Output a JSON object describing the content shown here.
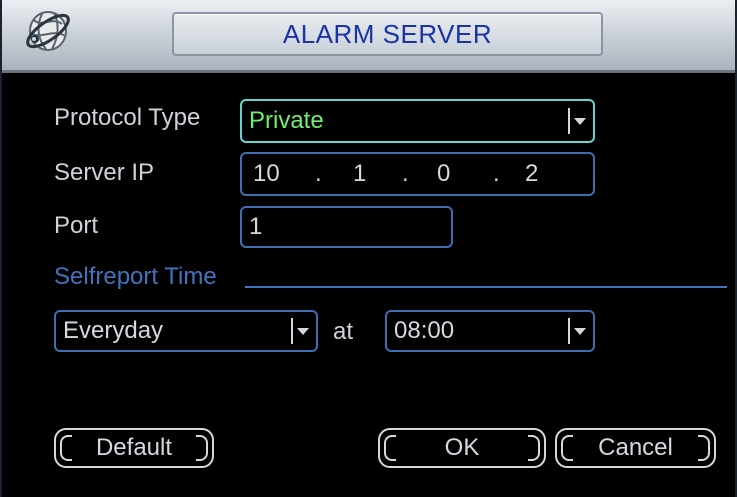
{
  "window": {
    "title": "ALARM SERVER"
  },
  "form": {
    "protocol_type": {
      "label": "Protocol Type",
      "value": "Private"
    },
    "server_ip": {
      "label": "Server IP",
      "octets": [
        "10",
        "1",
        "0",
        "2"
      ]
    },
    "port": {
      "label": "Port",
      "value": "1"
    }
  },
  "selfreport": {
    "section_title": "Selfreport Time",
    "frequency": "Everyday",
    "at_label": "at",
    "time": "08:00"
  },
  "buttons": {
    "default_label": "Default",
    "ok_label": "OK",
    "cancel_label": "Cancel"
  },
  "icons": {
    "logo": "globe-logo-icon",
    "dropdown": "chevron-down-icon"
  },
  "colors": {
    "title_text": "#1a33a8",
    "highlight_border": "#5fd6d0",
    "highlight_text": "#6ff06a",
    "field_border": "#3e6fb3",
    "section_title": "#3f74c0"
  }
}
